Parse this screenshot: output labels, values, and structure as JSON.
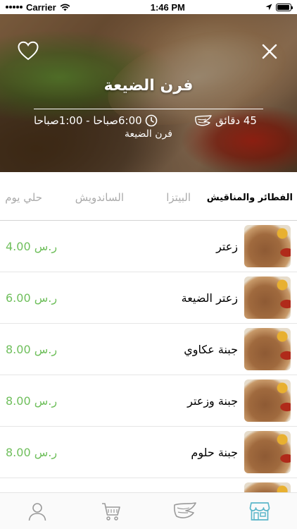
{
  "status_bar": {
    "carrier": "Carrier",
    "time": "1:46 PM",
    "battery_level": 0.95
  },
  "restaurant": {
    "name": "فرن الضيعة",
    "hours": "6:00صباحا - 1:00صباحا",
    "delivery_time": "45 دقائق",
    "subtitle": "فرن الضيعة"
  },
  "categories": [
    {
      "label": "الفطائر والمناقيش",
      "active": true
    },
    {
      "label": "البيتزا",
      "active": false
    },
    {
      "label": "الساندويش",
      "active": false
    },
    {
      "label": "حلي يوم",
      "active": false
    }
  ],
  "menu_items": [
    {
      "name": "زعتر",
      "price": "4.00 ر.س"
    },
    {
      "name": "زعتر الضيعة",
      "price": "6.00 ر.س"
    },
    {
      "name": "جبنة عكاوي",
      "price": "8.00 ر.س"
    },
    {
      "name": "جبنة وزعتر",
      "price": "8.00 ر.س"
    },
    {
      "name": "جبنة حلوم",
      "price": "8.00 ر.س"
    },
    {
      "name": "",
      "price": ""
    }
  ],
  "tabbar": {
    "items": [
      {
        "icon": "profile-icon"
      },
      {
        "icon": "cart-icon"
      },
      {
        "icon": "wing-icon"
      },
      {
        "icon": "store-icon",
        "active": true
      }
    ],
    "active_color": "#5bb6c9",
    "inactive_color": "#9a9a9a"
  },
  "colors": {
    "price_green": "#6fbf5c",
    "accent_teal": "#5bb6c9"
  }
}
